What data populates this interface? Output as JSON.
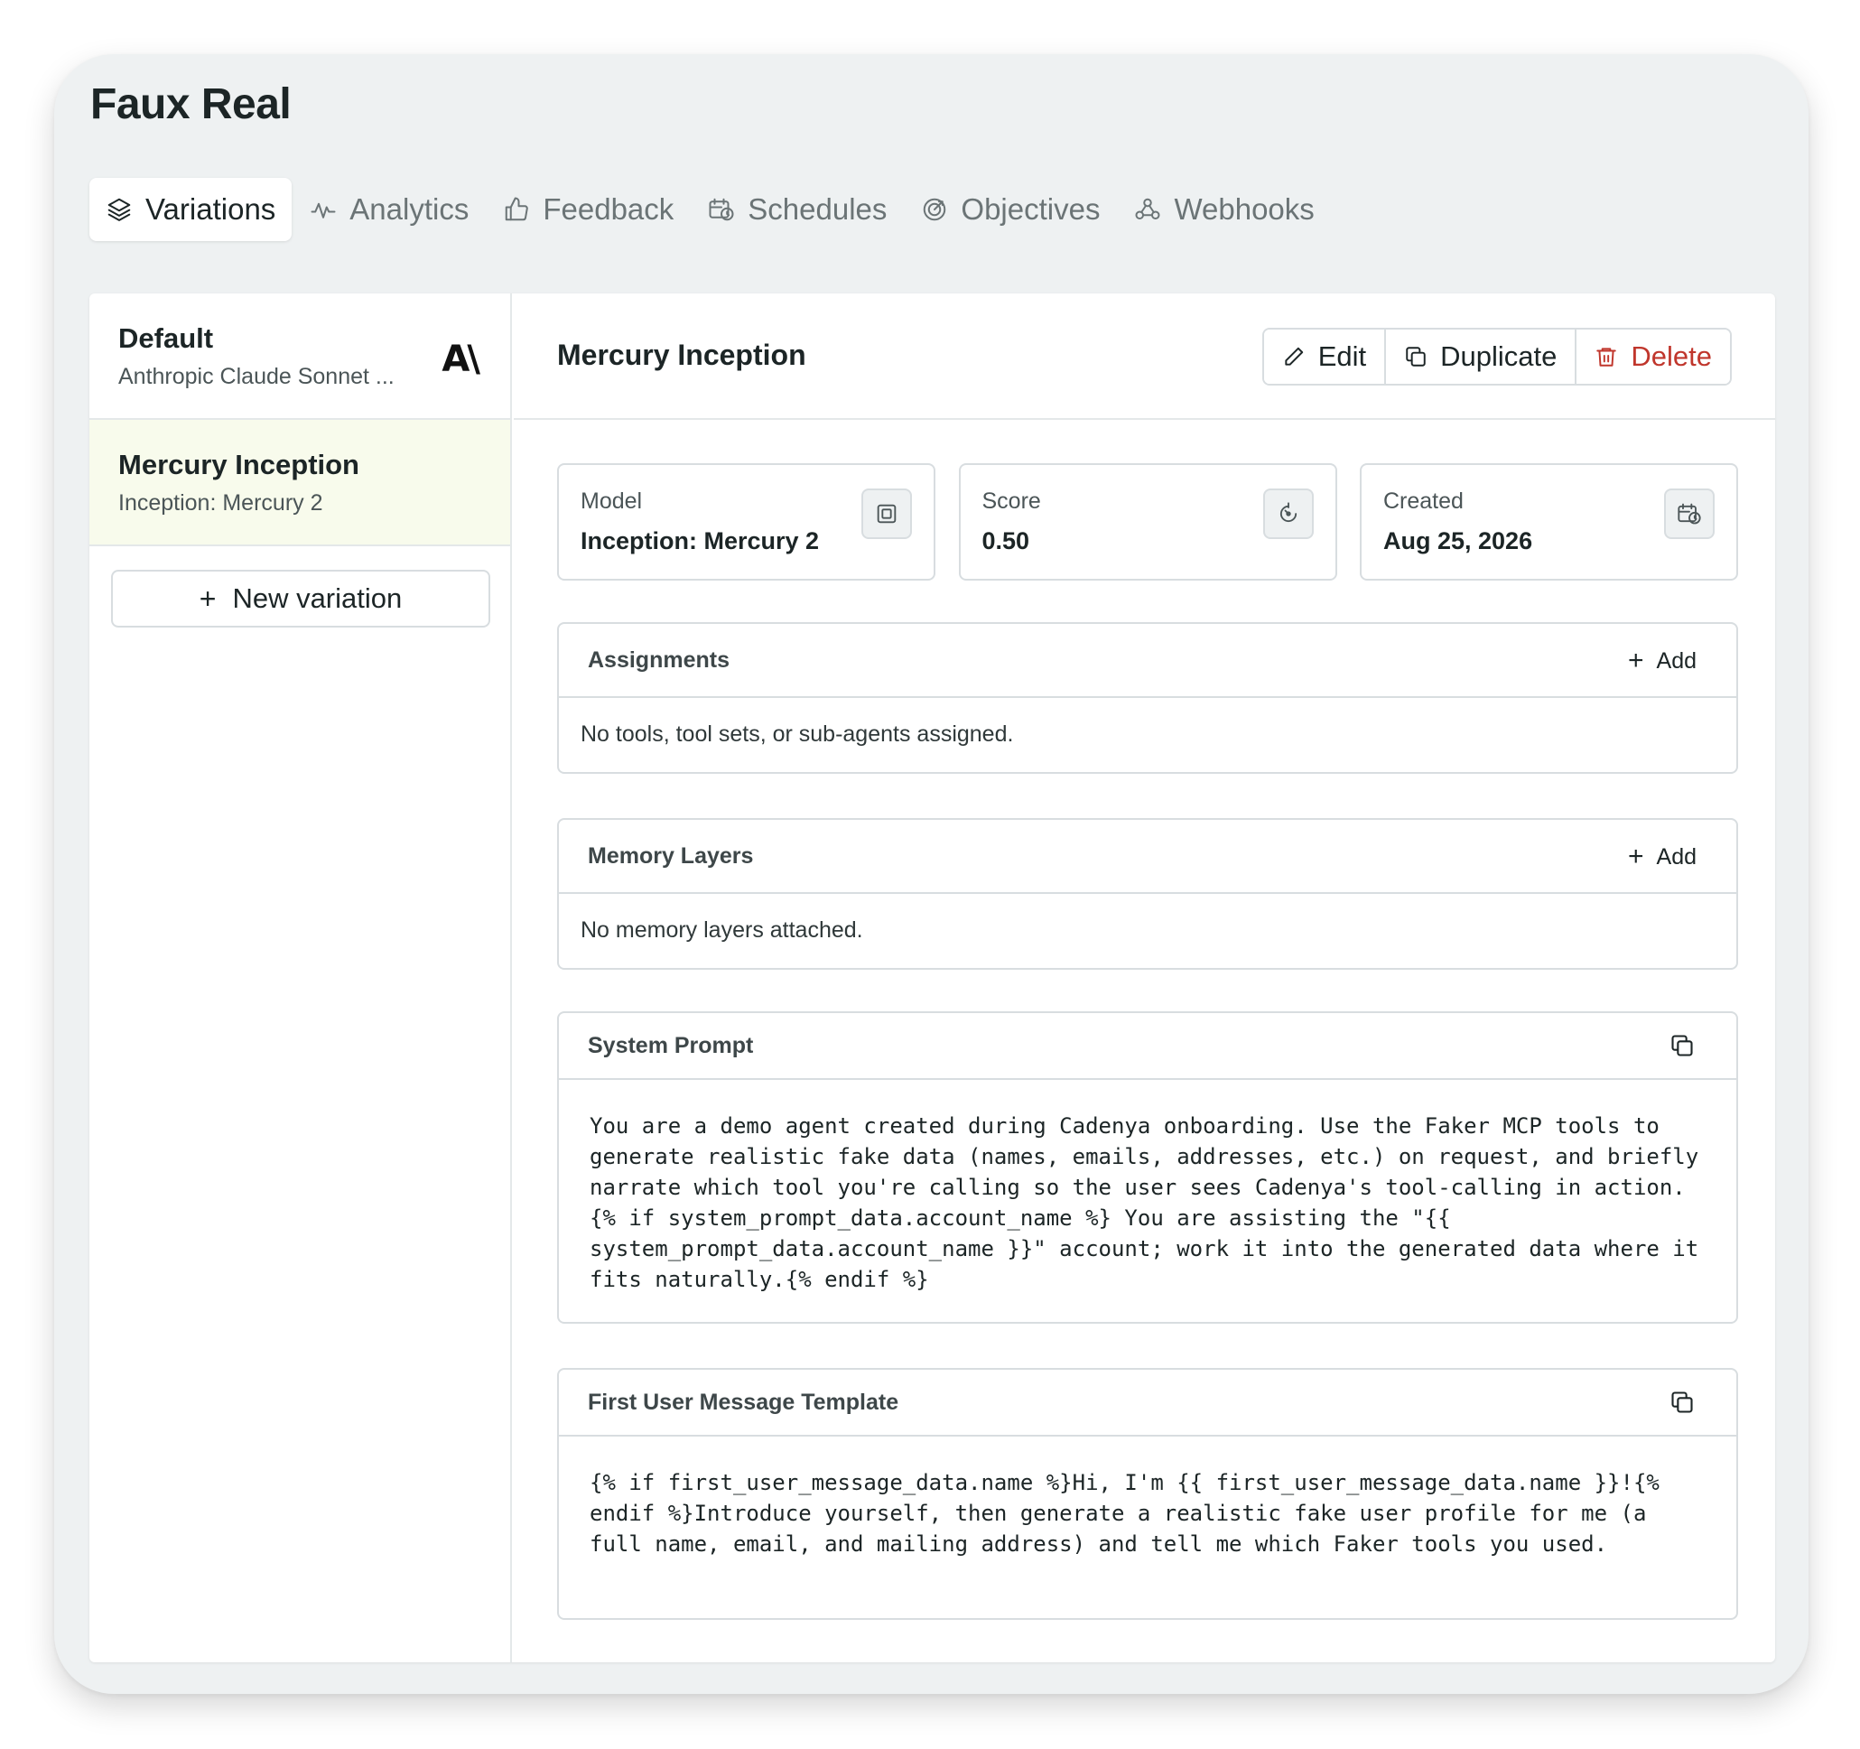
{
  "app": {
    "title": "Faux Real"
  },
  "tabs": [
    {
      "label": "Variations",
      "icon": "layers-icon",
      "active": true
    },
    {
      "label": "Analytics",
      "icon": "activity-icon"
    },
    {
      "label": "Feedback",
      "icon": "thumbs-up-icon"
    },
    {
      "label": "Schedules",
      "icon": "calendar-clock-icon"
    },
    {
      "label": "Objectives",
      "icon": "target-icon"
    },
    {
      "label": "Webhooks",
      "icon": "webhook-icon"
    }
  ],
  "sidebar": {
    "variations": [
      {
        "name": "Default",
        "subtitle": "Anthropic Claude Sonnet ...",
        "logo": "A\\"
      },
      {
        "name": "Mercury Inception",
        "subtitle": "Inception: Mercury 2",
        "selected": true
      }
    ],
    "new_variation_label": "New variation",
    "new_variation_icon": "+"
  },
  "main": {
    "title": "Mercury Inception",
    "actions": {
      "edit": "Edit",
      "duplicate": "Duplicate",
      "delete": "Delete"
    },
    "cards": [
      {
        "label": "Model",
        "value": "Inception: Mercury 2",
        "icon": "cpu-icon"
      },
      {
        "label": "Score",
        "value": "0.50",
        "icon": "gauge-icon"
      },
      {
        "label": "Created",
        "value": "Aug 25, 2026",
        "icon": "calendar-clock-icon"
      }
    ],
    "assignments": {
      "title": "Assignments",
      "add_label": "Add",
      "empty": "No tools, tool sets, or sub-agents assigned."
    },
    "memory_layers": {
      "title": "Memory Layers",
      "add_label": "Add",
      "empty": "No memory layers attached."
    },
    "system_prompt": {
      "title": "System Prompt",
      "text": "You are a demo agent created during Cadenya onboarding. Use the Faker MCP tools to generate realistic fake data (names, emails, addresses, etc.) on request, and briefly narrate which tool you're calling so the user sees Cadenya's tool-calling in action.{% if system_prompt_data.account_name %} You are assisting the \"{{ system_prompt_data.account_name }}\" account; work it into the generated data where it fits naturally.{% endif %}"
    },
    "first_user_message": {
      "title": "First User Message Template",
      "text": "{% if first_user_message_data.name %}Hi, I'm {{ first_user_message_data.name }}!{% endif %}Introduce yourself, then generate a realistic fake user profile for me (a full name, email, and mailing address) and tell me which Faker tools you used."
    }
  },
  "colors": {
    "danger": "#c0362c",
    "selected_bg": "#f8fbec",
    "window_bg": "#eef1f2"
  }
}
